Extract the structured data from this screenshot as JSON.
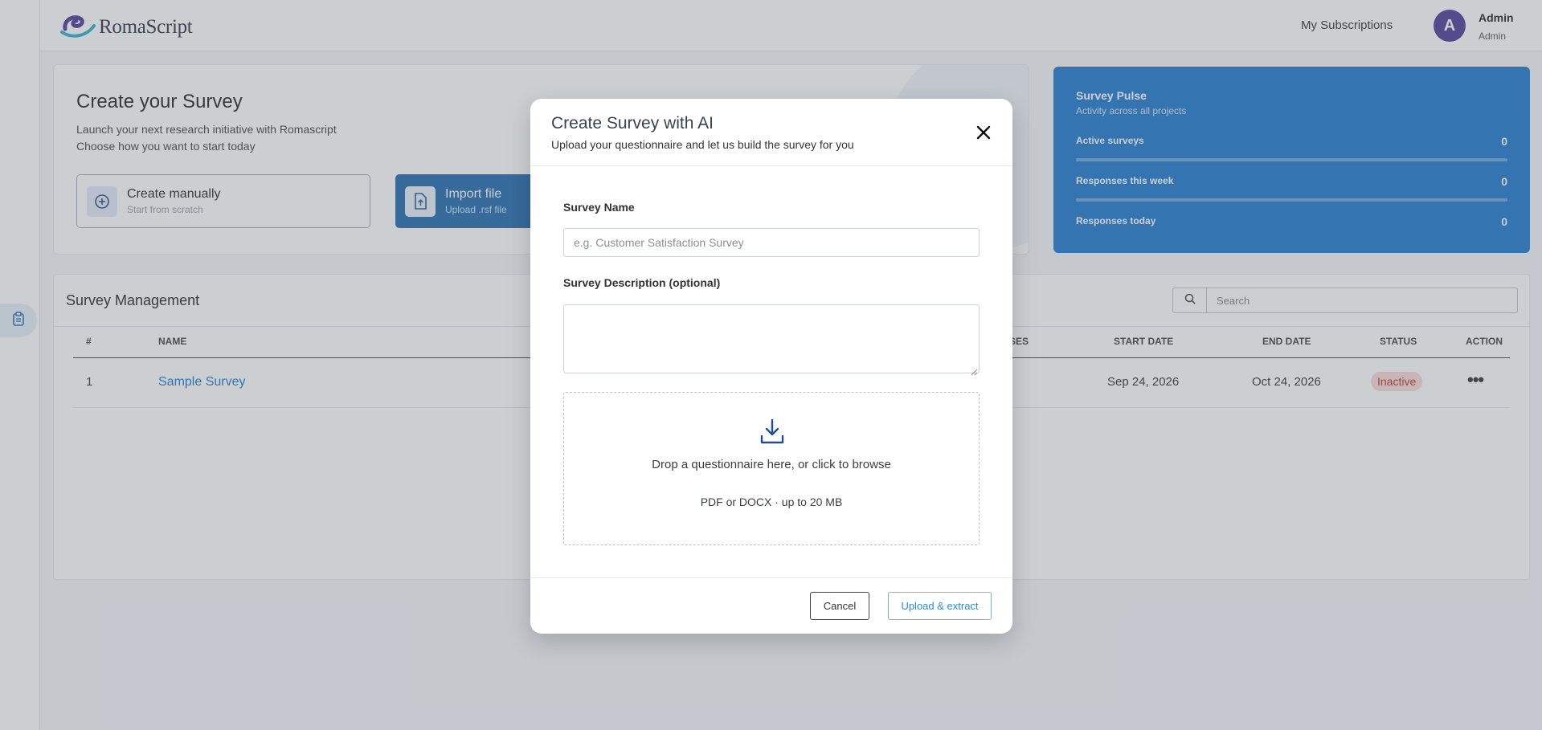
{
  "header": {
    "logo_text": "RomaScript",
    "subscriptions_link": "My Subscriptions",
    "avatar_initial": "A",
    "user_name": "Admin",
    "user_role": "Admin"
  },
  "sidebar": {
    "items": [
      {
        "icon": "clipboard-icon",
        "active": true
      }
    ]
  },
  "create": {
    "title": "Create your Survey",
    "line1": "Launch your next research initiative with Romascript",
    "line2": "Choose how you want to start today",
    "manual_label": "Create manually",
    "manual_sub": "Start from scratch",
    "import_label": "Import file",
    "import_sub": "Upload .rsf file"
  },
  "pulse": {
    "title": "Survey Pulse",
    "subtitle": "Activity across all projects",
    "stats": [
      {
        "label": "Active surveys",
        "value": "0"
      },
      {
        "label": "Responses this week",
        "value": "0"
      },
      {
        "label": "Responses today",
        "value": "0"
      }
    ]
  },
  "management": {
    "title": "Survey Management",
    "search_placeholder": "Search",
    "columns": [
      "#",
      "NAME",
      "SES",
      "START DATE",
      "END DATE",
      "STATUS",
      "ACTION"
    ],
    "rows": [
      {
        "num": "1",
        "name": "Sample Survey",
        "start": "Sep 24, 2026",
        "end": "Oct 24, 2026",
        "status": "Inactive"
      }
    ]
  },
  "modal": {
    "title": "Create Survey with AI",
    "subtitle": "Upload your questionnaire and let us build the survey for you",
    "name_label": "Survey Name",
    "name_placeholder": "e.g. Customer Satisfaction Survey",
    "desc_label": "Survey Description (optional)",
    "drop_text": "Drop a questionnaire here, or click to browse",
    "drop_hint": "PDF or DOCX · up to 20 MB",
    "cancel_label": "Cancel",
    "upload_label": "Upload & extract"
  },
  "colors": {
    "brand_blue": "#0b6cc9",
    "import_blue": "#0d5ea8",
    "avatar": "#3b2d8f",
    "inactive_badge_bg": "#f9d6d6",
    "inactive_badge_text": "#b42318"
  }
}
